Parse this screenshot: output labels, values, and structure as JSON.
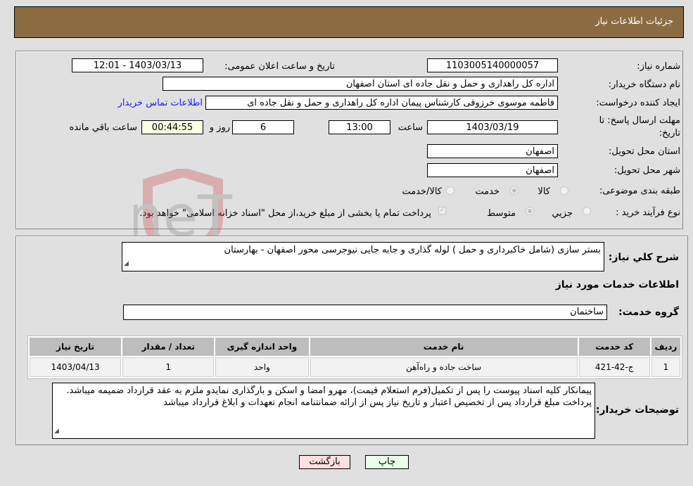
{
  "header": {
    "title": "جزئیات اطلاعات نیاز"
  },
  "details": {
    "need_number_label": "شماره نیاز:",
    "need_number": "1103005140000057",
    "announce_label": "تاریخ و ساعت اعلان عمومی:",
    "announce_value": "1403/03/13 - 12:01",
    "buyer_org_label": "نام دستگاه خریدار:",
    "buyer_org": "اداره کل راهداری و حمل و نقل جاده ای استان اصفهان",
    "creator_label": "ایجاد کننده درخواست:",
    "creator": "فاطمه موسوی خرزوقی کارشناس پیمان اداره کل راهداری و حمل و نقل جاده ای",
    "contact_link": "اطلاعات تماس خریدار",
    "deadline_label": "مهلت ارسال پاسخ: تا تاریخ:",
    "deadline_date": "1403/03/19",
    "time_label": "ساعت",
    "deadline_time": "13:00",
    "days_value": "6",
    "days_label": "روز و",
    "remaining_time": "00:44:55",
    "remaining_label": "ساعت باقي مانده",
    "province_label": "استان محل تحویل:",
    "province": "اصفهان",
    "city_label": "شهر محل تحویل:",
    "city": "اصفهان",
    "category_label": "طبقه بندی موضوعی:",
    "category_options": [
      "کالا",
      "خدمت",
      "کالا/خدمت"
    ],
    "category_selected": "خدمت",
    "process_label": "نوع فرآیند خرید :",
    "process_options": [
      "جزیي",
      "متوسط"
    ],
    "process_selected": "متوسط",
    "treasury_note": "پرداخت تمام یا بخشی از مبلغ خرید،از محل \"اسناد خزانه اسلامی\" خواهد بود."
  },
  "description": {
    "label": "شرح كلي نياز:",
    "value": "بستر سازی (شامل خاکبرداری و حمل ) لوله گذاری و جابه جایی نیوجرسی محور اصفهان - بهارستان"
  },
  "services": {
    "section_title": "اطلاعات خدمات مورد نیاز",
    "group_label": "گروه خدمت:",
    "group_value": "ساختمان",
    "columns": [
      "ردیف",
      "کد خدمت",
      "نام خدمت",
      "واحد اندازه گیری",
      "تعداد / مقدار",
      "تاریخ نیاز"
    ],
    "rows": [
      [
        "1",
        "ج-42-421",
        "ساخت جاده و راه‌آهن",
        "واحد",
        "1",
        "1403/04/13"
      ]
    ]
  },
  "buyer_notes": {
    "label": "توضیحات خریدار:",
    "value": "پیمانکار کلیه اسناد پیوست را پس از تکمیل(فرم استعلام قیمت)، مهرو امضا و اسکن و بارگذاری نمایدو ملزم به عقد قرارداد ضمیمه میباشد. پرداخت مبلغ قرارداد پس از تخصیص اعتبار و تاریخ نیاز پس از ارائه ضمانتنامه انجام تعهدات و ابلاغ قرارداد میباشد"
  },
  "buttons": {
    "print": "چاپ",
    "back": "بازگشت"
  },
  "watermark": {
    "text": "AriaTender.neT"
  },
  "colors": {
    "header_bg": "#8b6c42",
    "print_bg": "#eaffea",
    "back_bg": "#ffe0e0",
    "link": "#1a1aff"
  }
}
